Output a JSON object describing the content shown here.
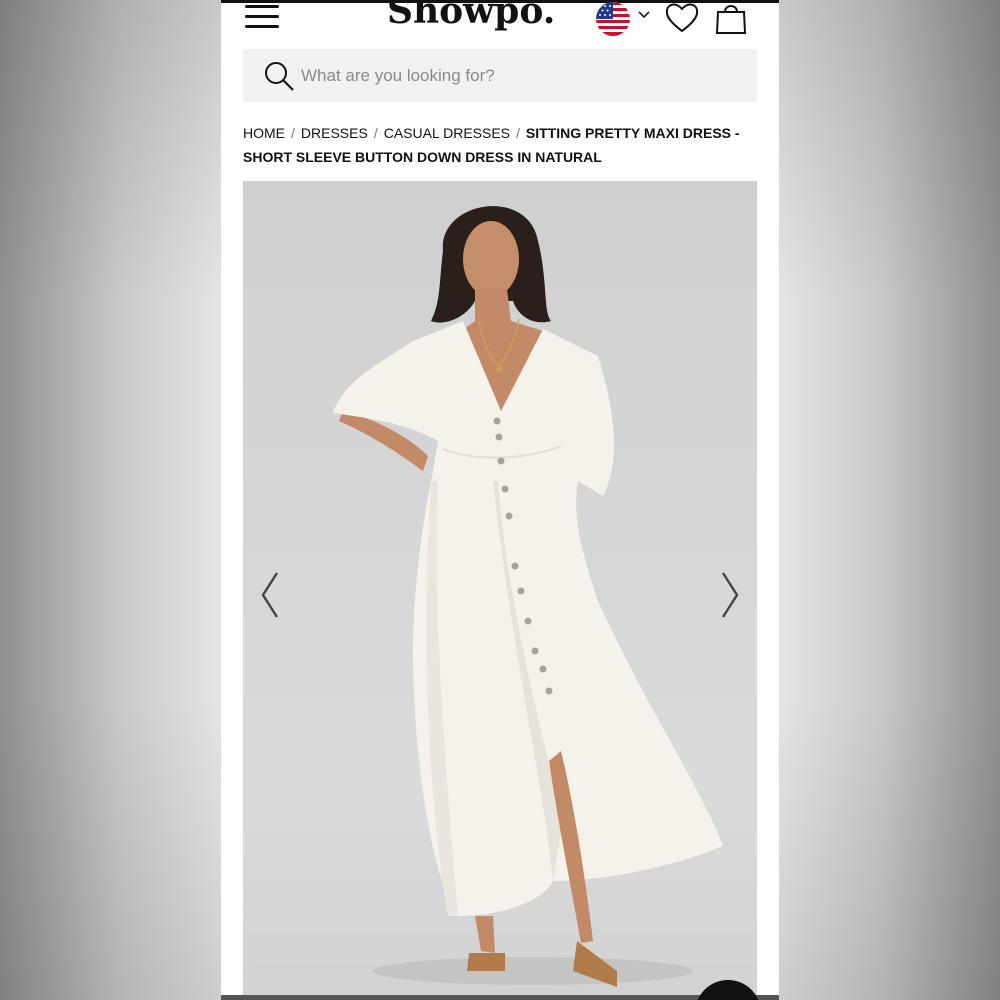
{
  "header": {
    "brand": "Showpo.",
    "region_flag": "us-flag-icon"
  },
  "search": {
    "placeholder": "What are you looking for?"
  },
  "breadcrumb": {
    "items": [
      "HOME",
      "DRESSES",
      "CASUAL DRESSES"
    ],
    "separator": "/",
    "current": "Sitting Pretty Maxi Dress - Short Sleeve Button Down Dress in Natural"
  },
  "gallery": {
    "image": "white-maxi-dress-model-photo",
    "prev": "chevron-left-icon",
    "next": "chevron-right-icon"
  },
  "colors": {
    "text": "#111111",
    "search_bg": "#f1f1f1",
    "photo_bg": "#d6d6d6"
  }
}
